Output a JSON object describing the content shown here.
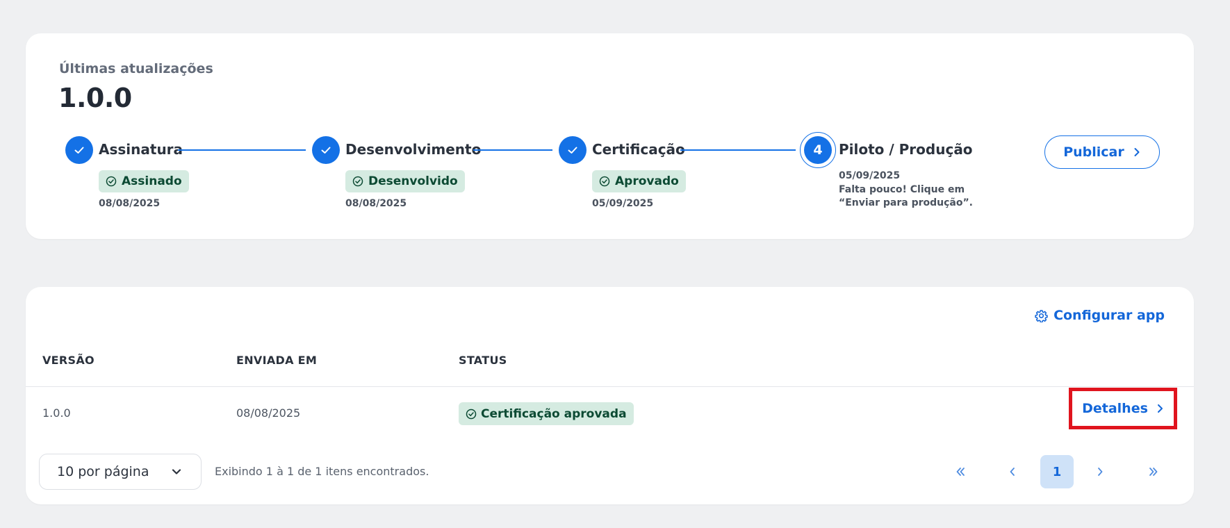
{
  "updates": {
    "subtitle": "Últimas atualizações",
    "version": "1.0.0",
    "steps": [
      {
        "title": "Assinatura",
        "badge": "Assinado",
        "date": "08/08/2025",
        "state": "done"
      },
      {
        "title": "Desenvolvimento",
        "badge": "Desenvolvido",
        "date": "08/08/2025",
        "state": "done"
      },
      {
        "title": "Certificação",
        "badge": "Aprovado",
        "date": "05/09/2025",
        "state": "done"
      },
      {
        "title": "Piloto / Produção",
        "number": "4",
        "date": "05/09/2025",
        "note_line1": "Falta pouco! Clique em",
        "note_line2": "“Enviar para produção”.",
        "state": "current"
      }
    ],
    "publish_label": "Publicar"
  },
  "versions": {
    "config_label": "Configurar app",
    "columns": [
      "VERSÃO",
      "ENVIADA EM",
      "STATUS"
    ],
    "rows": [
      {
        "version": "1.0.0",
        "sent_at": "08/08/2025",
        "status": "Certificação aprovada",
        "action": "Detalhes"
      }
    ],
    "per_page": "10 por página",
    "showing": "Exibindo 1 à 1 de 1 itens encontrados.",
    "current_page": "1"
  },
  "colors": {
    "accent": "#1471e6",
    "success_bg": "#d5ebe1",
    "success_text": "#0c4a33",
    "highlight": "#e0141e"
  },
  "icons": [
    "check-icon",
    "check-circle-icon",
    "chevron-right-icon",
    "gear-icon",
    "chevron-down-icon",
    "double-chevron-left-icon",
    "chevron-left-icon",
    "double-chevron-right-icon"
  ]
}
